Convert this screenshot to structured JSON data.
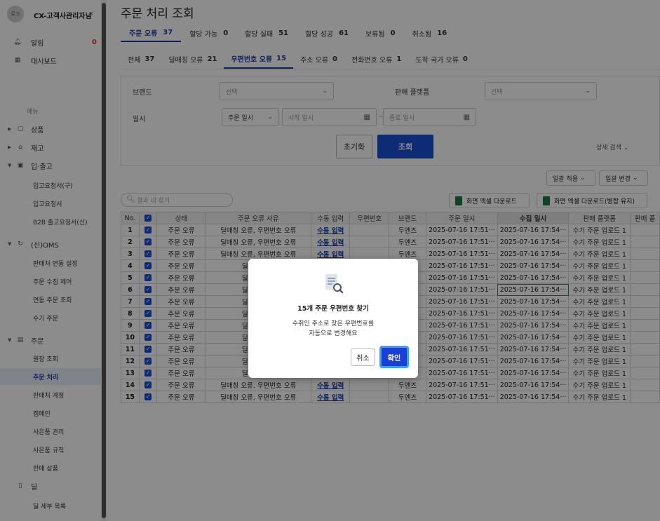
{
  "sidebar": {
    "logo": "로고",
    "user": "CX-고객사관리자님",
    "collapse_icon": "«",
    "notifications": {
      "label": "알림",
      "count": "0"
    },
    "dashboard": "대시보드",
    "section": "메뉴",
    "menu": [
      {
        "label": "상품"
      },
      {
        "label": "재고"
      },
      {
        "label": "입·출고"
      }
    ],
    "inout_subs": [
      "입고요청서(구)",
      "입고요청서",
      "B2B 출고요청서(신)"
    ],
    "oms": "(신)OMS",
    "oms_subs": [
      "판매처 연동 설정",
      "주문 수집 제어",
      "연동 주문 조회",
      "수기 주문"
    ],
    "order": "주문",
    "order_subs": [
      "원장 조회",
      "주문 처리",
      "판매처 계정",
      "캠페인",
      "사은품 관리",
      "사은품 규칙",
      "판매 상품",
      "딜",
      "딜 세부 목록"
    ]
  },
  "main": {
    "title": "주문 처리 조회",
    "tabs1": [
      {
        "label": "주문 오류",
        "count": "37"
      },
      {
        "label": "할당 가능",
        "count": "0"
      },
      {
        "label": "할당 실패",
        "count": "51"
      },
      {
        "label": "할당 성공",
        "count": "61"
      },
      {
        "label": "보류됨",
        "count": "0"
      },
      {
        "label": "취소됨",
        "count": "16"
      }
    ],
    "tabs2": [
      {
        "label": "전체",
        "count": "37"
      },
      {
        "label": "딜매칭 오류",
        "count": "21"
      },
      {
        "label": "우편번호 오류",
        "count": "15"
      },
      {
        "label": "주소 오류",
        "count": "0"
      },
      {
        "label": "전화번호 오류",
        "count": "1"
      },
      {
        "label": "도착 국가 오류",
        "count": "0"
      }
    ],
    "filters": {
      "brand_label": "브랜드",
      "brand_placeholder": "선택",
      "platform_label": "판매 플랫폼",
      "platform_placeholder": "선택",
      "date_label": "일시",
      "date_type": "주문 일시",
      "start_placeholder": "시작 일시",
      "dash": "~",
      "end_placeholder": "종료 일시",
      "reset": "초기화",
      "search": "조회",
      "advanced": "상세 검색"
    },
    "bulk_apply": "일괄 적용",
    "bulk_change": "일괄 변경",
    "result_search_placeholder": "결과 내 찾기",
    "excel_download": "화면 엑셀 다운로드",
    "excel_download_merged": "화면 엑셀 다운로드(병합 유지)",
    "table": {
      "headers": [
        "No.",
        "",
        "상태",
        "주문 오류 사유",
        "수동 입력",
        "우편번호",
        "브랜드",
        "주문 일시",
        "수집 일시",
        "판매 플랫폼",
        "판매 플"
      ],
      "rows": [
        {
          "no": "1",
          "status": "주문 오류",
          "reason": "딜매칭 오류, 우편번호 오류",
          "manual": "수동 입력",
          "zip": "",
          "brand": "두엔즈",
          "order_at": "2025-07-16 17:51···",
          "collect_at": "2025-07-16 17:54···",
          "platform": "수기 주문 업로드 1"
        },
        {
          "no": "2",
          "status": "주문 오류",
          "reason": "딜매칭 오류, 우편번호 오류",
          "manual": "수동 입력",
          "zip": "",
          "brand": "두엔즈",
          "order_at": "2025-07-16 17:51···",
          "collect_at": "2025-07-16 17:54···",
          "platform": "수기 주문 업로드 1"
        },
        {
          "no": "3",
          "status": "주문 오류",
          "reason": "딜매칭 오류, 우편번호 오류",
          "manual": "수동 입력",
          "zip": "",
          "brand": "두엔즈",
          "order_at": "2025-07-16 17:51···",
          "collect_at": "2025-07-16 17:54···",
          "platform": "수기 주문 업로드 1"
        },
        {
          "no": "4",
          "status": "주문 오류",
          "reason": "딜매칭 오류",
          "manual": "",
          "zip": "",
          "brand": "두엔즈",
          "order_at": "2025-07-16 17:51···",
          "collect_at": "2025-07-16 17:54···",
          "platform": "수기 주문 업로드 1"
        },
        {
          "no": "5",
          "status": "주문 오류",
          "reason": "딜매칭 오류",
          "manual": "",
          "zip": "",
          "brand": "두엔즈",
          "order_at": "2025-07-16 17:51···",
          "collect_at": "2025-07-16 17:54···",
          "platform": "수기 주문 업로드 1"
        },
        {
          "no": "6",
          "status": "주문 오류",
          "reason": "딜매칭 오류",
          "manual": "",
          "zip": "",
          "brand": "두엔즈",
          "order_at": "2025-07-16 17:51···",
          "collect_at": "2025-07-16 17:54···",
          "platform": "수기 주문 업로드 1"
        },
        {
          "no": "7",
          "status": "주문 오류",
          "reason": "딜매칭 오류",
          "manual": "",
          "zip": "",
          "brand": "두엔즈",
          "order_at": "2025-07-16 17:51···",
          "collect_at": "2025-07-16 17:54···",
          "platform": "수기 주문 업로드 1"
        },
        {
          "no": "8",
          "status": "주문 오류",
          "reason": "딜매칭 오류",
          "manual": "",
          "zip": "",
          "brand": "두엔즈",
          "order_at": "2025-07-16 17:51···",
          "collect_at": "2025-07-16 17:54···",
          "platform": "수기 주문 업로드 1"
        },
        {
          "no": "9",
          "status": "주문 오류",
          "reason": "딜매칭 오류",
          "manual": "",
          "zip": "",
          "brand": "두엔즈",
          "order_at": "2025-07-16 17:51···",
          "collect_at": "2025-07-16 17:54···",
          "platform": "수기 주문 업로드 1"
        },
        {
          "no": "10",
          "status": "주문 오류",
          "reason": "딜매칭 오류",
          "manual": "",
          "zip": "",
          "brand": "두엔즈",
          "order_at": "2025-07-16 17:51···",
          "collect_at": "2025-07-16 17:54···",
          "platform": "수기 주문 업로드 1"
        },
        {
          "no": "11",
          "status": "주문 오류",
          "reason": "딜매칭 오류",
          "manual": "",
          "zip": "",
          "brand": "두엔즈",
          "order_at": "2025-07-16 17:51···",
          "collect_at": "2025-07-16 17:54···",
          "platform": "수기 주문 업로드 1"
        },
        {
          "no": "12",
          "status": "주문 오류",
          "reason": "딜매칭 오류",
          "manual": "",
          "zip": "",
          "brand": "두엔즈",
          "order_at": "2025-07-16 17:51···",
          "collect_at": "2025-07-16 17:54···",
          "platform": "수기 주문 업로드 1"
        },
        {
          "no": "13",
          "status": "주문 오류",
          "reason": "딜매칭 오류",
          "manual": "",
          "zip": "",
          "brand": "두엔즈",
          "order_at": "2025-07-16 17:51···",
          "collect_at": "2025-07-16 17:54···",
          "platform": "수기 주문 업로드 1"
        },
        {
          "no": "14",
          "status": "주문 오류",
          "reason": "딜매칭 오류, 우편번호 오류",
          "manual": "수동 입력",
          "zip": "",
          "brand": "두엔즈",
          "order_at": "2025-07-16 17:51···",
          "collect_at": "2025-07-16 17:54···",
          "platform": "수기 주문 업로드 1"
        },
        {
          "no": "15",
          "status": "주문 오류",
          "reason": "딜매칭 오류, 우편번호 오류",
          "manual": "수동 입력",
          "zip": "",
          "brand": "두엔즈",
          "order_at": "2025-07-16 17:51···",
          "collect_at": "2025-07-16 17:54···",
          "platform": "수기 주문 업로드 1"
        }
      ]
    }
  },
  "modal": {
    "title": "15개 주문 우편번호 찾기",
    "body_line1": "수취인 주소로 찾은 우편번호를",
    "body_line2": "자동으로 변경해요",
    "cancel": "취소",
    "confirm": "확인"
  },
  "colors": {
    "primary": "#1a4fd6",
    "accent_tab": "#1c3fa8",
    "focus_ring": "#3aa0f0",
    "excel": "#1d7a45"
  }
}
